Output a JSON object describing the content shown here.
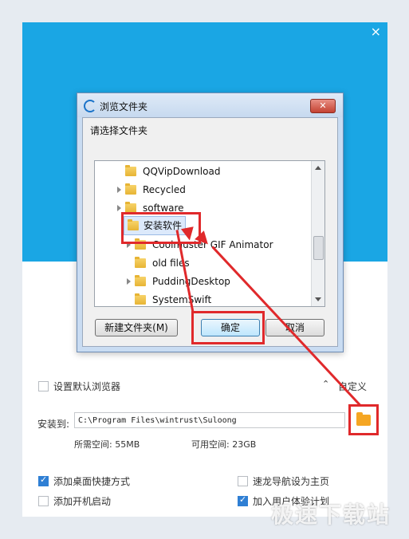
{
  "installer": {
    "close_symbol": "×",
    "set_default_browser": "设置默认浏览器",
    "custom_toggle": "自定义",
    "install_to_label": "安装到:",
    "install_path": "C:\\Program Files\\wintrust\\Suloong",
    "required_space": "所需空间: 55MB",
    "available_space": "可用空间: 23GB",
    "opt_desktop_shortcut": "添加桌面快捷方式",
    "opt_startup": "添加开机启动",
    "opt_homepage": "速龙导航设为主页",
    "opt_ux_program": "加入用户体验计划",
    "accent_color": "#1aa6e4"
  },
  "dialog": {
    "title": "浏览文件夹",
    "prompt": "请选择文件夹",
    "close_symbol": "✕",
    "tree": [
      {
        "label": "QQVipDownload"
      },
      {
        "label": "Recycled"
      },
      {
        "label": "software"
      },
      {
        "label": "安装软件"
      },
      {
        "label": "Coolmuster GIF Animator"
      },
      {
        "label": "old files"
      },
      {
        "label": "PuddingDesktop"
      },
      {
        "label": "SystemSwift"
      }
    ],
    "new_folder_button": "新建文件夹(M)",
    "ok_button": "确定",
    "cancel_button": "取消"
  },
  "watermark": "极速下载站",
  "annotation_color": "#e0292b"
}
